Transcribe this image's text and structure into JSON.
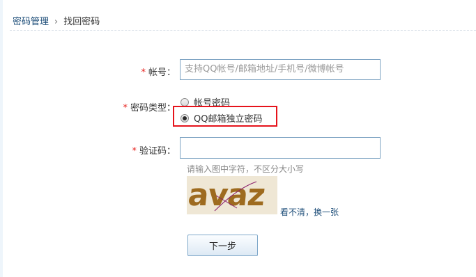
{
  "breadcrumb": {
    "parent": "密码管理",
    "separator": "›",
    "current": "找回密码"
  },
  "form": {
    "account_label": "帐号：",
    "account_placeholder": "支持QQ帐号/邮箱地址/手机号/微博帐号",
    "password_type_label": "密码类型：",
    "password_type_options": [
      {
        "label": "帐号密码",
        "selected": false
      },
      {
        "label": "QQ邮箱独立密码",
        "selected": true
      }
    ],
    "captcha_label": "验证码：",
    "captcha_value": "",
    "captcha_hint": "请输入图中字符，不区分大小写",
    "captcha_image_text": "avaz",
    "refresh_link": "看不清，换一张",
    "required_mark": "*",
    "next_button": "下一步"
  },
  "colors": {
    "required": "#e6201c",
    "highlight": "#e6131b",
    "link": "#1f4f7a",
    "captcha_text": "#9e6b1f"
  }
}
